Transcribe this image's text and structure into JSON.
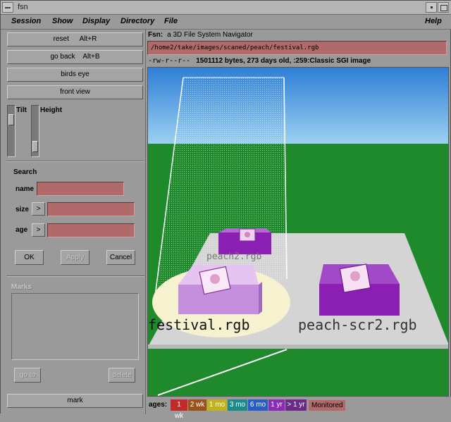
{
  "window": {
    "title": "fsn"
  },
  "menubar": [
    "Session",
    "Show",
    "Display",
    "Directory",
    "File",
    "Help"
  ],
  "left": {
    "buttons": [
      {
        "label": "reset",
        "shortcut": "Alt+R"
      },
      {
        "label": "go back",
        "shortcut": "Alt+B"
      },
      {
        "label": "birds eye"
      },
      {
        "label": "front view"
      }
    ],
    "sliders": {
      "tilt_label": "Tilt",
      "height_label": "Height",
      "tilt_level": 0.25,
      "height_level": 0.85
    },
    "search": {
      "title": "Search",
      "name_label": "name",
      "size_label": "size",
      "age_label": "age",
      "size_op": ">",
      "age_op": ">",
      "name_value": "",
      "size_value": "",
      "age_value": ""
    },
    "actions": {
      "ok": "OK",
      "apply": "Apply",
      "cancel": "Cancel"
    },
    "marks": {
      "title": "Marks",
      "goto": "go to",
      "delete": "delete"
    },
    "mark_button": "mark"
  },
  "info": {
    "app_name": "Fsn:",
    "app_subtitle": "a 3D File System Navigator",
    "path": "/home2/take/images/scaned/peach/festival.rgb",
    "permissions": "-rw-r--r--",
    "details": "1501112 bytes, 273 days old, :259:Classic SGI image"
  },
  "view": {
    "files": [
      {
        "name": "peach2.rgb"
      },
      {
        "name": "festival.rgb"
      },
      {
        "name": "peach-scr2.rgb"
      }
    ],
    "colors": {
      "sky_top": "#2e7fd6",
      "sky_bottom": "#8fc6f0",
      "ground": "#1f8a2c",
      "block_light": "#d79be8",
      "block_dark": "#8b1fb3"
    }
  },
  "ages": {
    "label": "ages:",
    "items": [
      {
        "label": "1 wk",
        "color": "#c22a2a"
      },
      {
        "label": "2 wk",
        "color": "#9a5218"
      },
      {
        "label": "1 mo",
        "color": "#c0b21a"
      },
      {
        "label": "3 mo",
        "color": "#1a8a8a"
      },
      {
        "label": "6 mo",
        "color": "#2a5cc8"
      },
      {
        "label": "1 yr",
        "color": "#8a2ab8"
      },
      {
        "label": "> 1 yr",
        "color": "#6a2a8a"
      }
    ],
    "monitored": "Monitored"
  }
}
